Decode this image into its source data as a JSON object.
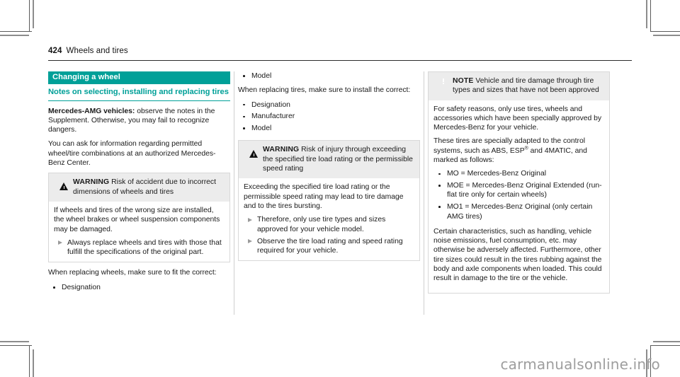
{
  "page": {
    "folio": "424",
    "running_head": "Wheels and tires",
    "watermark": "carmanualsonline.info"
  },
  "columns": {
    "left": {
      "chapter_bar": "Changing a wheel",
      "section_title": "Notes on selecting, installing and replacing tires",
      "para_lead_bold": "Mercedes-AMG vehicles:",
      "para_lead_rest": " observe the notes in the Supplement. Otherwise, you may fail to recognize dangers.",
      "para_2": "You can ask for information regarding permitted wheel/tire combinations at an authorized Mercedes-Benz Center.",
      "warning": {
        "icon": "warning-triangle-icon",
        "keyword": "WARNING",
        "title": " Risk of accident due to incorrect dimensions of wheels and tires",
        "body": "If wheels and tires of the wrong size are installed, the wheel brakes or wheel suspension components may be damaged.",
        "steps": [
          "Always replace wheels and tires with those that fulfill the specifications of the original part."
        ]
      },
      "para_3": "When replacing wheels, make sure to fit the correct:",
      "bullets": [
        "Designation"
      ]
    },
    "middle": {
      "bullets_top": [
        "Model"
      ],
      "para_1": "When replacing tires, make sure to install the correct:",
      "bullets_mid": [
        "Designation",
        "Manufacturer",
        "Model"
      ],
      "warning": {
        "icon": "warning-triangle-icon",
        "keyword": "WARNING",
        "title": " Risk of injury through exceeding the specified tire load rating or the permissible speed rating",
        "body": "Exceeding the specified tire load rating or the permissible speed rating may lead to tire damage and to the tires bursting.",
        "steps": [
          "Therefore, only use tire types and sizes approved for your vehicle model.",
          "Observe the tire load rating and speed rating required for your vehicle."
        ]
      }
    },
    "right": {
      "note": {
        "icon": "note-exclamation-icon",
        "keyword": "NOTE",
        "title": " Vehicle and tire damage through tire types and sizes that have not been approved",
        "body_1": "For safety reasons, only use tires, wheels and accessories which have been specially approved by Mercedes-Benz for your vehicle.",
        "body_2_a": "These tires are specially adapted to the control systems, such as ABS, ESP",
        "body_2_sup": "®",
        "body_2_b": " and 4MATIC, and marked as follows:",
        "bullets": [
          "MO = Mercedes-Benz Original",
          "MOE = Mercedes-Benz Original Extended (run-flat tire only for certain wheels)",
          "MO1 = Mercedes-Benz Original (only certain AMG tires)"
        ],
        "body_3": "Certain characteristics, such as handling, vehicle noise emissions, fuel consumption, etc. may otherwise be adversely affected. Furthermore, other tire sizes could result in the tires rubbing against the body and axle components when loaded. This could result in damage to the tire or the vehicle."
      }
    }
  },
  "colors": {
    "brand_teal": "#00a098",
    "alert_header_bg": "#ececec",
    "rule": "#2b2b2b"
  }
}
